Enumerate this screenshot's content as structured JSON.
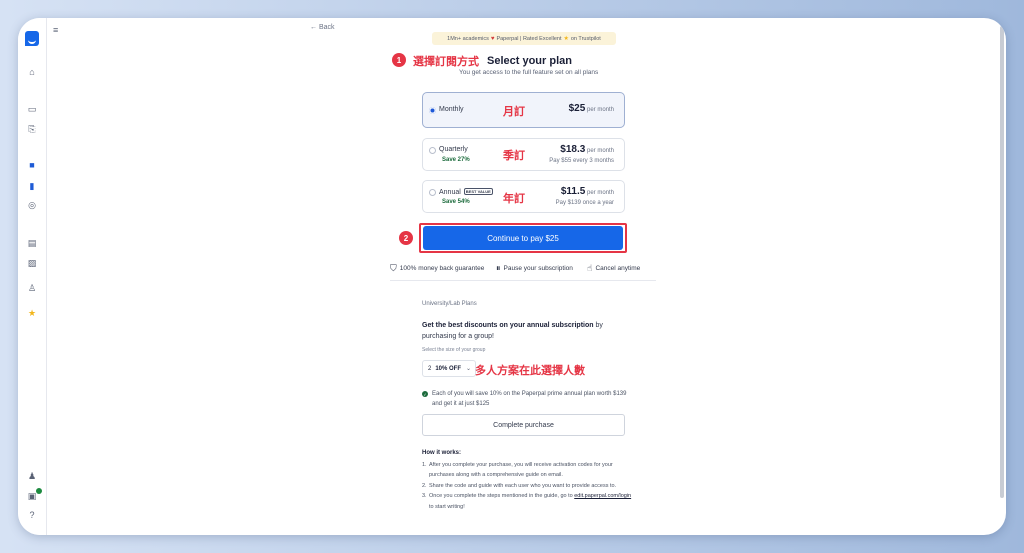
{
  "nav": {
    "back_label": "← Back",
    "collapse_icon": "≡"
  },
  "banner": {
    "prefix": "1Mn+ academics",
    "middle": "Paperpal | Rated Excellent",
    "suffix": "on Trustpilot"
  },
  "annotations": {
    "step1": "1",
    "step1_label": "選擇訂閱方式",
    "step2": "2",
    "monthly_label": "月訂",
    "quarterly_label": "季訂",
    "annual_label": "年訂",
    "group_label": "多人方案在此選擇人數"
  },
  "header": {
    "title": "Select your plan",
    "subtitle": "You get access to the full feature set on all plans"
  },
  "plans": [
    {
      "name": "Monthly",
      "price": "$25",
      "unit": "per month",
      "selected": true
    },
    {
      "name": "Quarterly",
      "save": "Save 27%",
      "price": "$18.3",
      "unit": "per month",
      "billing": "Pay $55 every 3 months",
      "selected": false
    },
    {
      "name": "Annual",
      "badge": "BEST VALUE",
      "save": "Save 54%",
      "price": "$11.5",
      "unit": "per month",
      "billing": "Pay $139 once a year",
      "selected": false
    }
  ],
  "cta": {
    "label": "Continue to pay $25"
  },
  "features": [
    {
      "icon": "shield-check-icon",
      "label": "100% money back guarantee"
    },
    {
      "icon": "pause-icon",
      "label": "Pause your subscription"
    },
    {
      "icon": "thumbs-up-icon",
      "label": "Cancel anytime"
    }
  ],
  "group": {
    "section_label": "University/Lab Plans",
    "headline_bold": "Get the best discounts on your annual subscription",
    "headline_rest": " by purchasing for a group!",
    "size_label": "Select the size of your group",
    "size_value": "2",
    "discount": "10% OFF",
    "savings_text": "Each of you will save 10% on the Paperpal prime annual plan worth $139 and get it at just $125",
    "complete_label": "Complete purchase"
  },
  "how": {
    "title": "How it works:",
    "steps": [
      "After you complete your purchase, you will receive activation codes for your purchases along with a comprehensive guide on email.",
      "Share the code and guide with each user who you want to provide access to.",
      "Once you complete the steps mentioned in the guide, go to"
    ],
    "link": "edit.paperpal.com/login",
    "link_suffix": " to start writing!"
  },
  "colors": {
    "accent": "#1667e8",
    "annotation_red": "#e53545",
    "save_green": "#1c6b3c",
    "banner_bg": "#fbf3d9"
  }
}
